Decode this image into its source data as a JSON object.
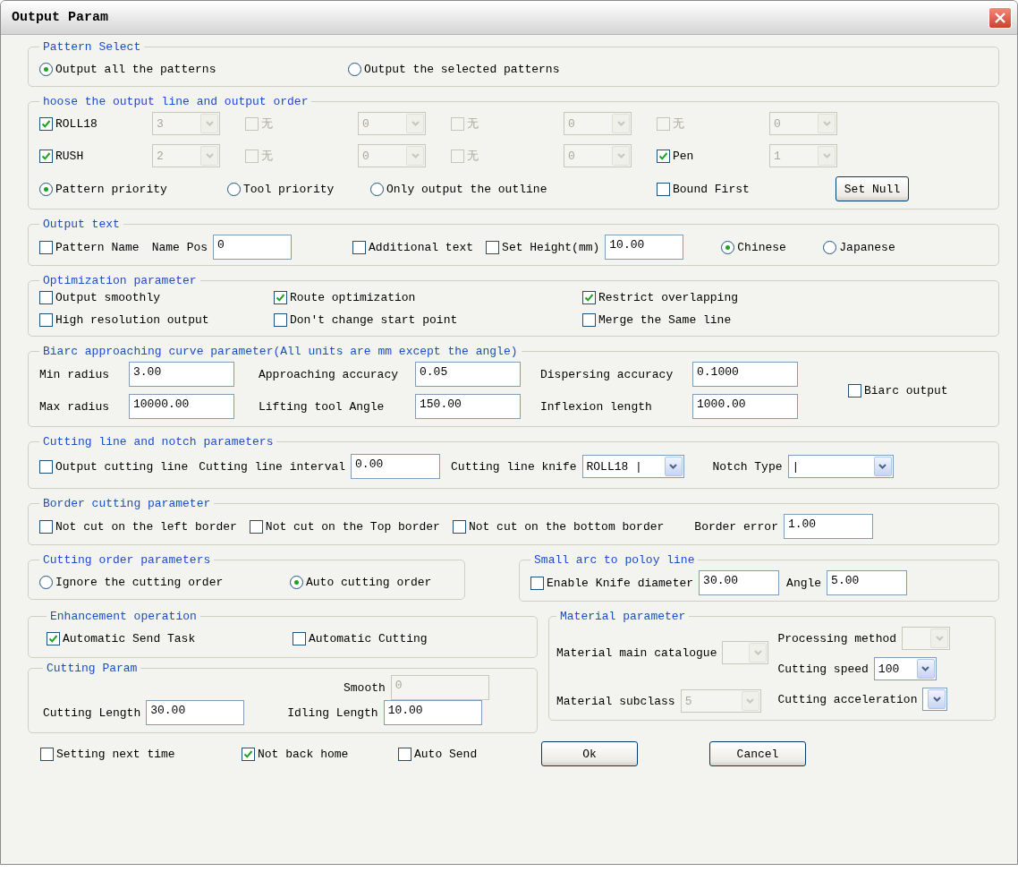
{
  "window": {
    "title": "Output Param"
  },
  "pattern_select": {
    "title": "Pattern Select",
    "options": [
      {
        "label": "Output all the patterns",
        "selected": true
      },
      {
        "label": "Output the selected patterns",
        "selected": false
      }
    ]
  },
  "output_line": {
    "title": "hoose the output line and output order",
    "rows": [
      [
        {
          "label": "ROLL18",
          "checked": true,
          "disabled": false,
          "value": "3"
        },
        {
          "label": "无",
          "checked": false,
          "disabled": true,
          "value": "0"
        },
        {
          "label": "无",
          "checked": false,
          "disabled": true,
          "value": "0"
        },
        {
          "label": "无",
          "checked": false,
          "disabled": true,
          "value": "0"
        }
      ],
      [
        {
          "label": "RUSH",
          "checked": true,
          "disabled": false,
          "value": "2"
        },
        {
          "label": "无",
          "checked": false,
          "disabled": true,
          "value": "0"
        },
        {
          "label": "无",
          "checked": false,
          "disabled": true,
          "value": "0"
        },
        {
          "label": "Pen",
          "checked": true,
          "disabled": false,
          "value": "1"
        }
      ]
    ],
    "priority": [
      {
        "label": "Pattern priority",
        "selected": true
      },
      {
        "label": "Tool priority",
        "selected": false
      },
      {
        "label": "Only output the outline",
        "selected": false
      }
    ],
    "bound_first": {
      "label": "Bound First",
      "checked": false
    },
    "set_null": "Set Null"
  },
  "output_text": {
    "title": "Output text",
    "pattern_name": {
      "label": "Pattern Name",
      "checked": false
    },
    "name_pos": {
      "label": "Name Pos",
      "value": "0"
    },
    "additional_text": {
      "label": "Additional text",
      "checked": false
    },
    "set_height": {
      "label": "Set Height(mm)",
      "checked": false,
      "value": "10.00"
    },
    "languages": [
      {
        "label": "Chinese",
        "selected": true
      },
      {
        "label": "Japanese",
        "selected": false
      }
    ]
  },
  "optimization": {
    "title": "Optimization parameter",
    "options": [
      {
        "label": "Output smoothly",
        "checked": false
      },
      {
        "label": "Route optimization",
        "checked": true
      },
      {
        "label": "Restrict overlapping",
        "checked": true
      },
      {
        "label": "High resolution output",
        "checked": false
      },
      {
        "label": "Don't change start point",
        "checked": false
      },
      {
        "label": "Merge the Same line",
        "checked": false
      }
    ]
  },
  "biarc": {
    "title": "Biarc approaching curve parameter(All units are mm except the angle)",
    "fields": [
      {
        "label": "Min radius",
        "value": "3.00"
      },
      {
        "label": "Approaching accuracy",
        "value": "0.05"
      },
      {
        "label": "Dispersing accuracy",
        "value": "0.1000"
      },
      {
        "label": "Max radius",
        "value": "10000.00"
      },
      {
        "label": "Lifting tool Angle",
        "value": "150.00"
      },
      {
        "label": "Inflexion length",
        "value": "1000.00"
      }
    ],
    "biarc_output": {
      "label": "Biarc output",
      "checked": false
    }
  },
  "cutting_line": {
    "title": "Cutting line and notch parameters",
    "output_cutting_line": {
      "label": "Output cutting line",
      "checked": false
    },
    "interval": {
      "label": "Cutting line interval",
      "value": "0.00"
    },
    "knife": {
      "label": "Cutting line knife",
      "value": "ROLL18 |"
    },
    "notch_type": {
      "label": "Notch Type",
      "value": "|"
    }
  },
  "border": {
    "title": "Border cutting parameter",
    "options": [
      {
        "label": "Not cut on the left border",
        "checked": false
      },
      {
        "label": "Not cut on the Top border",
        "checked": false
      },
      {
        "label": "Not cut on the bottom border",
        "checked": false
      }
    ],
    "border_error": {
      "label": "Border error",
      "value": "1.00"
    }
  },
  "cutting_order": {
    "title": "Cutting order parameters",
    "options": [
      {
        "label": "Ignore the cutting order",
        "selected": false
      },
      {
        "label": "Auto cutting order",
        "selected": true
      }
    ]
  },
  "small_arc": {
    "title": "Small arc to poloy line",
    "enable": {
      "label": "Enable",
      "checked": false
    },
    "knife_diameter": {
      "label": "Knife diameter",
      "value": "30.00"
    },
    "angle": {
      "label": "Angle",
      "value": "5.00"
    }
  },
  "enhancement": {
    "title": "Enhancement operation",
    "options": [
      {
        "label": "Automatic Send Task",
        "checked": true
      },
      {
        "label": "Automatic Cutting",
        "checked": false
      }
    ]
  },
  "cutting_param": {
    "title": "Cutting Param",
    "smooth": {
      "label": "Smooth",
      "value": "0",
      "disabled": true
    },
    "cutting_length": {
      "label": "Cutting Length",
      "value": "30.00"
    },
    "idling_length": {
      "label": "Idling Length",
      "value": "10.00"
    }
  },
  "material": {
    "title": "Material parameter",
    "main_catalogue": {
      "label": "Material main catalogue",
      "disabled": true
    },
    "subclass": {
      "label": "Material subclass",
      "value": "5",
      "disabled": true
    },
    "processing_method": {
      "label": "Processing method",
      "disabled": true
    },
    "cutting_speed": {
      "label": "Cutting speed",
      "value": "100",
      "disabled": false
    },
    "cutting_acceleration": {
      "label": "Cutting acceleration",
      "disabled": false
    }
  },
  "footer": {
    "options": [
      {
        "label": "Setting next time",
        "checked": false
      },
      {
        "label": "Not back home",
        "checked": true
      },
      {
        "label": "Auto Send",
        "checked": false
      }
    ],
    "buttons": [
      "Ok",
      "Cancel"
    ]
  }
}
